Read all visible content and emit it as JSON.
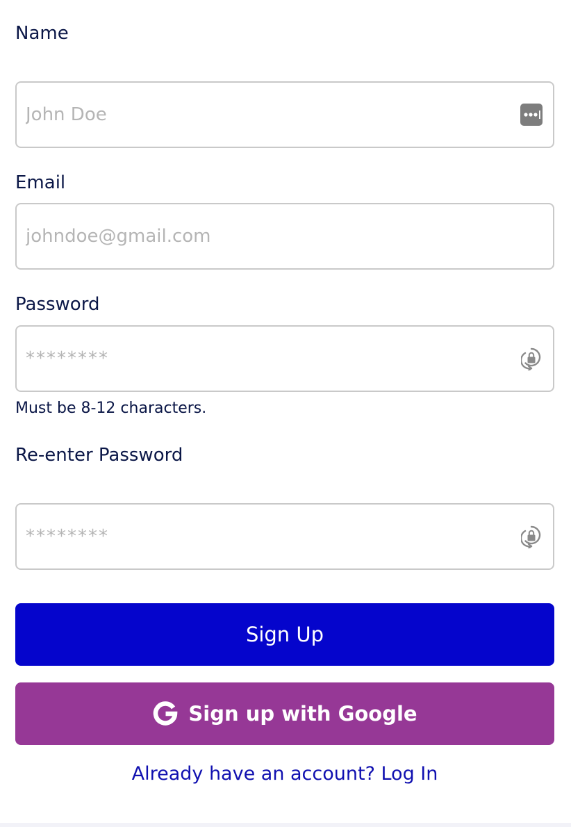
{
  "form": {
    "name": {
      "label": "Name",
      "placeholder": "John Doe",
      "value": ""
    },
    "email": {
      "label": "Email",
      "placeholder": "johndoe@gmail.com",
      "value": ""
    },
    "password": {
      "label": "Password",
      "placeholder": "********",
      "value": "",
      "hint": "Must be 8-12 characters."
    },
    "confirm_password": {
      "label": "Re-enter Password",
      "placeholder": "********",
      "value": ""
    }
  },
  "actions": {
    "signup_label": "Sign Up",
    "google_label": "Sign up with Google",
    "login_prompt": "Already have an account? Log In"
  },
  "colors": {
    "primary": "#0505cc",
    "google_button": "#963896",
    "link": "#1010b0",
    "text": "#0b1747",
    "border": "#c9c9c9",
    "placeholder": "#b5b5b5"
  },
  "icons": {
    "name_field": "autofill-dots-icon",
    "password_field": "password-manager-lock-icon",
    "confirm_field": "password-manager-lock-icon",
    "google": "google-g-icon"
  }
}
